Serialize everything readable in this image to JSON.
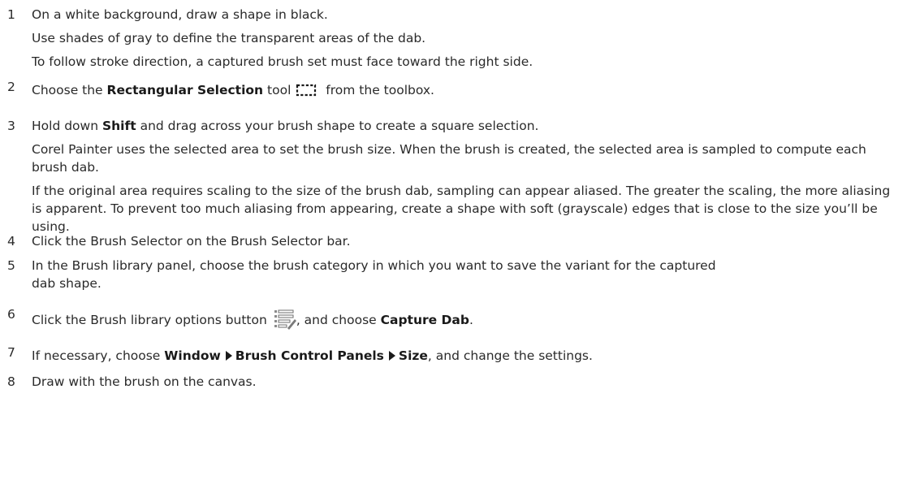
{
  "steps": [
    {
      "number": "1",
      "lines": [
        "On a white background, draw a shape in black.",
        "Use shades of gray to define the transparent areas of the dab.",
        "To follow stroke direction, a captured brush set must face toward the right side."
      ]
    },
    {
      "number": "2",
      "pre": "Choose the ",
      "bold": "Rectangular Selection",
      "mid": " tool",
      "icon": "rectangular-selection-icon",
      "post": " from the toolbox."
    },
    {
      "number": "3",
      "pre": "Hold down ",
      "bold": "Shift",
      "post": " and drag across your brush shape to create a square selection.",
      "para1": "Corel Painter uses the selected area to set the brush size. When the brush is created, the selected area is sampled to compute each brush dab.",
      "para2": "If the original area requires scaling to the size of the brush dab, sampling can appear aliased. The greater the scaling, the more aliasing is apparent. To prevent too much aliasing from appearing, create a shape with soft (grayscale) edges that is close to the size you’ll be using."
    },
    {
      "number": "4",
      "text": "Click the Brush Selector on the Brush Selector bar."
    },
    {
      "number": "5",
      "text": "In the Brush library panel, choose the brush category in which you want to save the variant for the captured dab shape."
    },
    {
      "number": "6",
      "pre": "Click the Brush library options button",
      "icon": "brush-library-options-icon",
      "mid": ", and choose ",
      "bold": "Capture Dab",
      "post": "."
    },
    {
      "number": "7",
      "pre": "If necessary, choose ",
      "menu1": "Window",
      "menu2": "Brush Control Panels",
      "menu3": "Size",
      "post": ", and change the settings."
    },
    {
      "number": "8",
      "text": "Draw with the brush on the canvas."
    }
  ]
}
